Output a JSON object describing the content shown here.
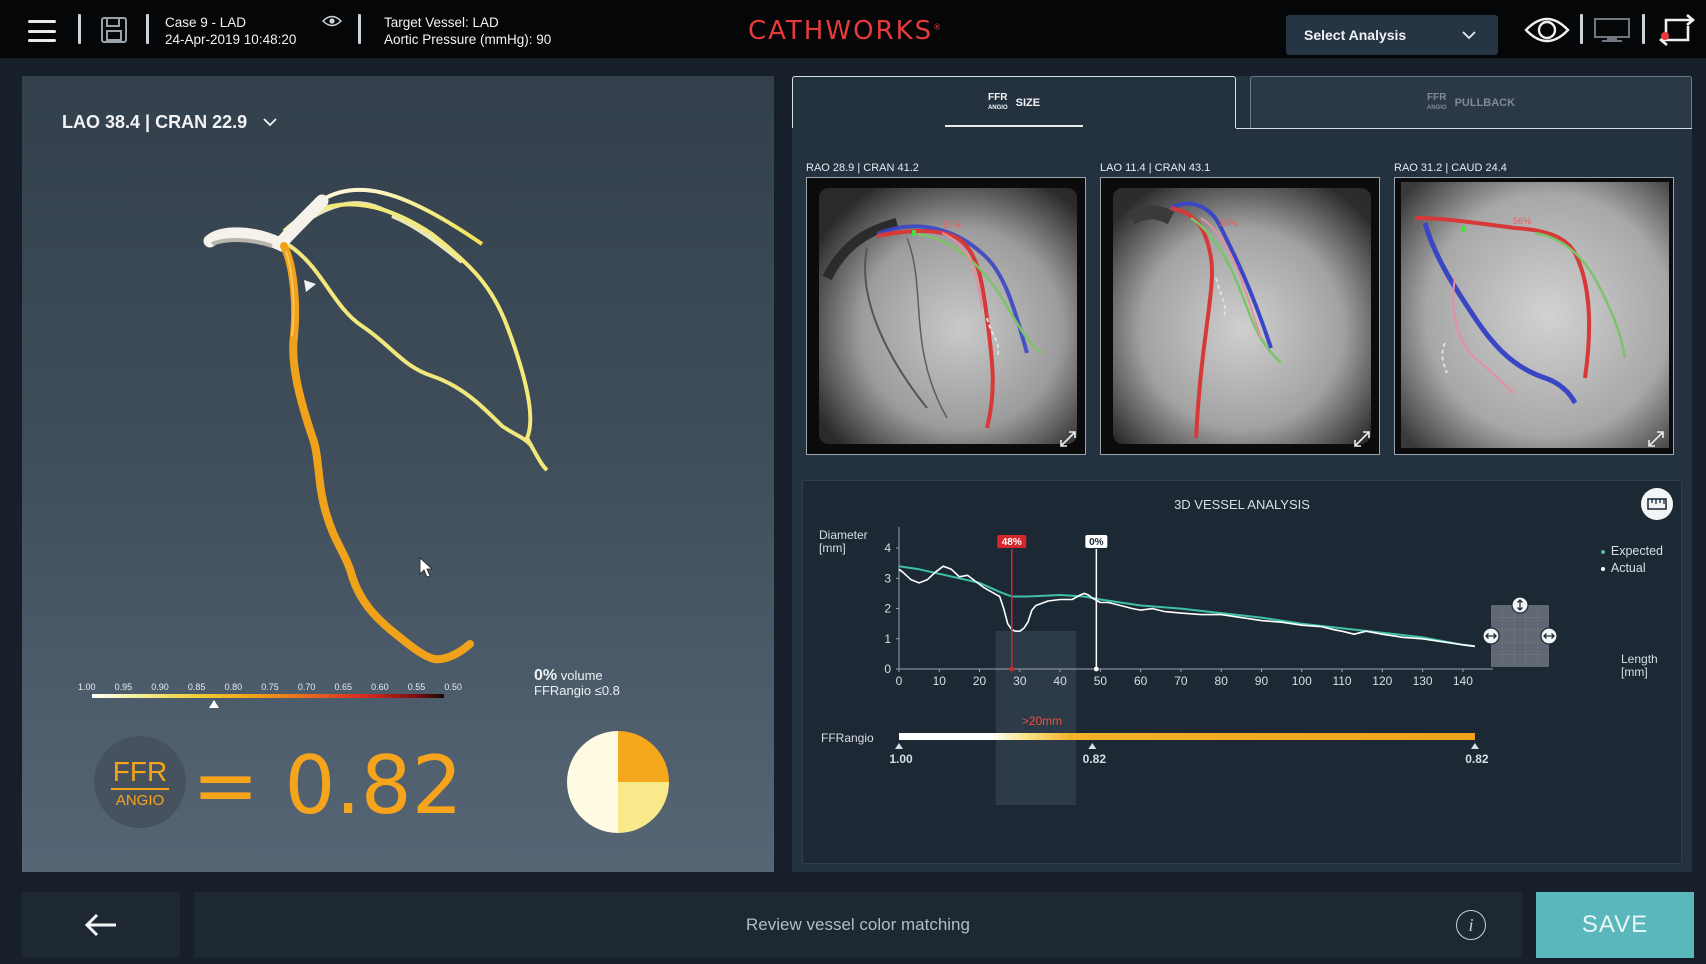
{
  "header": {
    "case_name": "Case 9 - LAD",
    "case_datetime": "24-Apr-2019 10:48:20",
    "target_vessel": "Target Vessel: LAD",
    "aortic_pressure": "Aortic Pressure (mmHg): 90",
    "logo": "CATHWORKS",
    "logo_mark": "®",
    "select_analysis_label": "Select Analysis",
    "icons": [
      "menu-icon",
      "save-icon",
      "eye-icon",
      "eye-large-icon",
      "monitor-icon",
      "sync-icon"
    ]
  },
  "left_panel": {
    "view_label": "LAO 38.4 | CRAN 22.9",
    "scale_ticks": [
      "1.00",
      "0.95",
      "0.90",
      "0.85",
      "0.80",
      "0.75",
      "0.70",
      "0.65",
      "0.60",
      "0.55",
      "0.50"
    ],
    "scale_marker_value": 0.82,
    "volume_percent": "0%",
    "volume_label": "volume",
    "volume_criteria": "FFRangio ≤0.8",
    "ffr_top": "FFR",
    "ffr_bottom": "ANGIO",
    "ffr_equals": "=",
    "ffr_value": "0.82",
    "pie_fractions": [
      0.25,
      0.25,
      0.5
    ],
    "pie_colors": [
      "#f5a81c",
      "#f8e98a",
      "#fffbe3"
    ]
  },
  "right_panel": {
    "tab_size_ffr": "FFR",
    "tab_size_angio": "ANGIO",
    "tab_size_label": "SIZE",
    "tab_pullback_ffr": "FFR",
    "tab_pullback_angio": "ANGIO",
    "tab_pullback_label": "PULLBACK",
    "angio_views": [
      {
        "label": "RAO 28.9 | CRAN 41.2",
        "stenosis": "57%"
      },
      {
        "label": "LAO 11.4 | CRAN 43.1",
        "stenosis": "55%"
      },
      {
        "label": "RAO 31.2 | CAUD 24.4",
        "stenosis": "56%"
      }
    ],
    "analysis_title": "3D VESSEL ANALYSIS",
    "legend": [
      {
        "label": "Expected",
        "color": "#3fc1a6"
      },
      {
        "label": "Actual",
        "color": "#ffffff"
      }
    ]
  },
  "chart_data": {
    "type": "line",
    "title": "3D VESSEL ANALYSIS",
    "ylabel": "Diameter\n[mm]",
    "xlabel": "Length\n[mm]",
    "ylabel_lines": [
      "Diameter",
      "[mm]"
    ],
    "xlabel_lines": [
      "Length",
      "[mm]"
    ],
    "xlim": [
      0,
      145
    ],
    "ylim": [
      0,
      4.5
    ],
    "x_ticks": [
      0,
      10,
      20,
      30,
      40,
      50,
      60,
      70,
      80,
      90,
      100,
      110,
      120,
      130,
      140
    ],
    "y_ticks": [
      0,
      1,
      2,
      3,
      4
    ],
    "series": [
      {
        "name": "Expected",
        "color": "#3fc1a6",
        "x": [
          0,
          5,
          10,
          15,
          20,
          25,
          28,
          32,
          40,
          46,
          50,
          60,
          70,
          80,
          90,
          100,
          110,
          120,
          130,
          140,
          143
        ],
        "y": [
          3.4,
          3.3,
          3.15,
          3.0,
          2.85,
          2.55,
          2.4,
          2.4,
          2.45,
          2.4,
          2.3,
          2.1,
          2.0,
          1.85,
          1.7,
          1.5,
          1.35,
          1.2,
          1.05,
          0.8,
          0.75
        ]
      },
      {
        "name": "Actual",
        "color": "#ffffff",
        "x": [
          0,
          1,
          3,
          5,
          7,
          9,
          11,
          13,
          15,
          17,
          19,
          21,
          23,
          25,
          26,
          27,
          28,
          29,
          30,
          31,
          32,
          33,
          34,
          35,
          37,
          40,
          43,
          45,
          46,
          47,
          48,
          50,
          52,
          55,
          58,
          60,
          63,
          66,
          70,
          75,
          80,
          85,
          90,
          95,
          100,
          105,
          108,
          110,
          113,
          116,
          120,
          125,
          130,
          135,
          140,
          143
        ],
        "y": [
          3.3,
          3.2,
          2.95,
          2.85,
          2.95,
          3.2,
          3.4,
          3.3,
          3.05,
          3.1,
          2.9,
          2.7,
          2.55,
          2.4,
          2.0,
          1.5,
          1.3,
          1.25,
          1.25,
          1.35,
          1.55,
          1.95,
          2.1,
          2.15,
          2.25,
          2.3,
          2.3,
          2.45,
          2.5,
          2.45,
          2.35,
          2.2,
          2.2,
          2.1,
          2.0,
          1.95,
          2.0,
          1.9,
          1.85,
          1.8,
          1.8,
          1.7,
          1.6,
          1.55,
          1.45,
          1.4,
          1.3,
          1.25,
          1.15,
          1.25,
          1.15,
          1.05,
          1.0,
          0.9,
          0.8,
          0.75
        ]
      }
    ],
    "markers": [
      {
        "x": 28,
        "label": "48%",
        "color": "#d8262d"
      },
      {
        "x": 49,
        "label": "0%",
        "color": "#ffffff"
      }
    ],
    "highlight_range": [
      24,
      44
    ],
    "ffr_track": {
      "label": "FFRangio",
      "segment_label": ">20mm",
      "values": [
        {
          "x": 0,
          "label": "1.00"
        },
        {
          "x": 48,
          "label": "0.82"
        },
        {
          "x": 143,
          "label": "0.82"
        }
      ]
    }
  },
  "footer": {
    "message": "Review vessel color matching",
    "info_symbol": "i",
    "save_label": "SAVE"
  }
}
